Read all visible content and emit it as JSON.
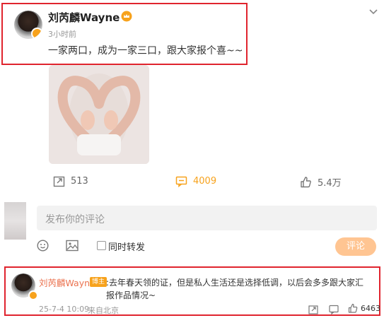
{
  "post": {
    "author": "刘芮麟Wayne",
    "crown_icon": "crown-icon",
    "time": "3小时前",
    "text": "一家两口，成为一家三口，跟大家报个喜~~"
  },
  "stats": {
    "repost_count": "513",
    "comment_count": "4009",
    "like_count": "5.4万"
  },
  "comment_box": {
    "placeholder": "发布你的评论",
    "repost_checkbox_label": "同时转发",
    "submit_label": "评论"
  },
  "reply": {
    "author": "刘芮麟Wayne",
    "badge": "博主",
    "text": ":去年春天领的证，但是私人生活还是选择低调，以后会多多跟大家汇报作品情况~",
    "date": "25-7-4 10:09",
    "source": "来自北京",
    "like_count": "6463"
  },
  "colors": {
    "accent_orange": "#f7a21c",
    "highlight_box": "#e0242e"
  }
}
